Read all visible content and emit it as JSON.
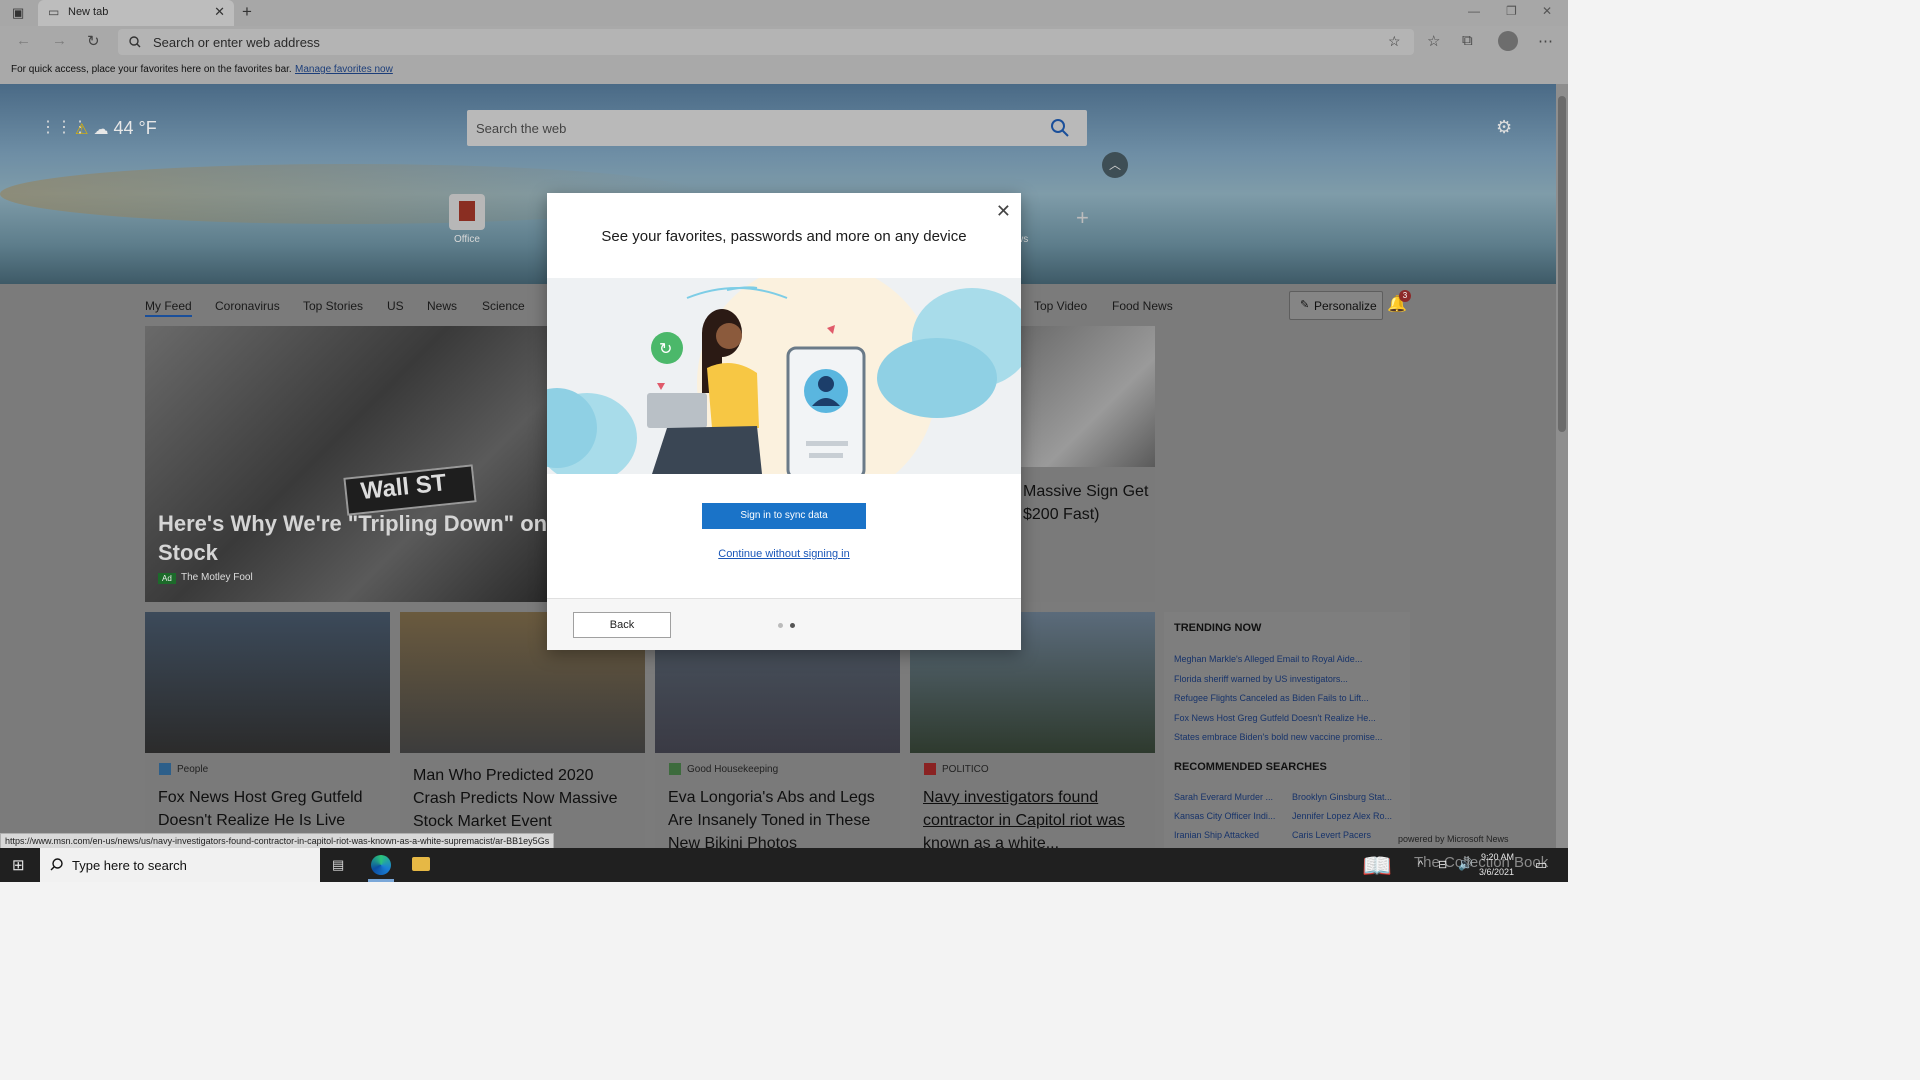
{
  "browser": {
    "tab_title": "New tab",
    "address_placeholder": "Search or enter web address",
    "favorites_bar_text": "For quick access, place your favorites here on the favorites bar.",
    "favorites_bar_link": "Manage favorites now"
  },
  "newtab": {
    "weather": "44 °F",
    "web_search_placeholder": "Search the web",
    "quick_links": [
      "Office"
    ],
    "quick_link_partial": "ws",
    "nav": [
      "My Feed",
      "Coronavirus",
      "Top Stories",
      "US",
      "News",
      "Science",
      "Top Video",
      "Food News"
    ],
    "personalize": "Personalize",
    "notif_count": "3",
    "hero_headline": "Here's Why We're \"Tripling Down\" on Stock",
    "hero_ad": "Ad",
    "hero_source": "The Motley Fool",
    "hero_sign": "Wall ST",
    "right_card_headline": "Massive Sign Get $200 Fast)",
    "cards": [
      {
        "source": "People",
        "headline": "Fox News Host Greg Gutfeld Doesn't Realize He Is Live"
      },
      {
        "source": "",
        "headline": "Man Who Predicted 2020 Crash Predicts Now Massive Stock Market Event"
      },
      {
        "source": "Good Housekeeping",
        "headline": "Eva Longoria's Abs and Legs Are Insanely Toned in These New Bikini Photos"
      },
      {
        "source": "POLITICO",
        "headline": "Navy investigators found contractor in Capitol riot was known as a white..."
      }
    ],
    "trending_title": "TRENDING NOW",
    "trending": [
      "Meghan Markle's Alleged Email to Royal Aide...",
      "Florida sheriff warned by US investigators...",
      "Refugee Flights Canceled as Biden Fails to Lift...",
      "Fox News Host Greg Gutfeld Doesn't Realize He...",
      "States embrace Biden's bold new vaccine promise..."
    ],
    "recommended_title": "RECOMMENDED SEARCHES",
    "recommended": [
      "Sarah Everard Murder ...",
      "Brooklyn Ginsburg Stat...",
      "Kansas City Officer Indi...",
      "Jennifer Lopez Alex Ro...",
      "Iranian Ship Attacked",
      "Caris Levert Pacers"
    ],
    "powered_by": "powered by Microsoft News"
  },
  "modal": {
    "title": "See your favorites, passwords and more on any device",
    "sign_in_button": "Sign in to sync data",
    "continue_link": "Continue without signing in",
    "back_button": "Back"
  },
  "status_url": "https://www.msn.com/en-us/news/us/navy-investigators-found-contractor-in-capitol-riot-was-known-as-a-white-supremacist/ar-BB1ey5Gs",
  "taskbar": {
    "search_placeholder": "Type here to search",
    "time": "9:20 AM",
    "date": "3/6/2021",
    "watermark": "The Collection Book"
  },
  "colors": {
    "accent": "#1a73c8",
    "link": "#1a57b8"
  }
}
